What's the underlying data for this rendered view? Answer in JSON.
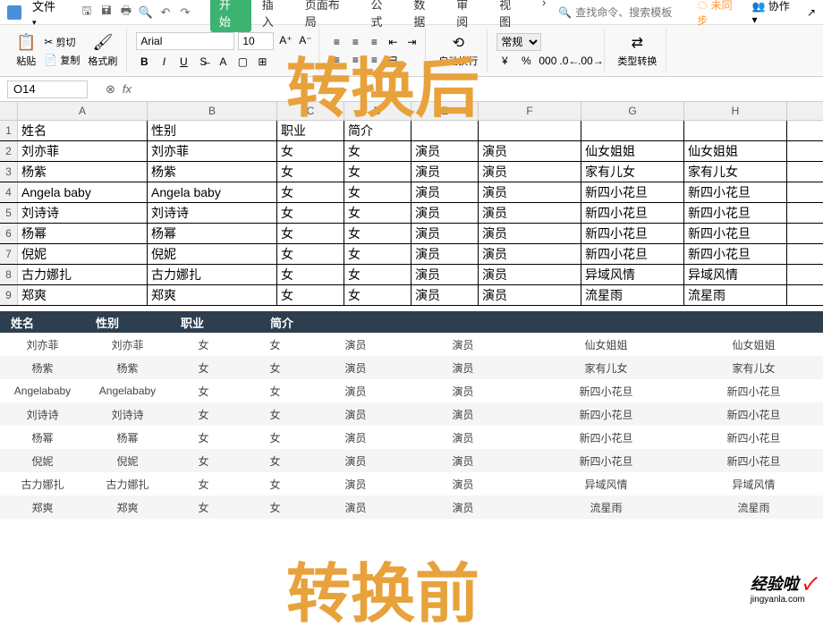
{
  "menu": {
    "file": "文件",
    "tabs": [
      "开始",
      "插入",
      "页面布局",
      "公式",
      "数据",
      "审阅",
      "视图"
    ],
    "search_placeholder": "查找命令、搜索模板",
    "sync": "未同步",
    "collab": "协作"
  },
  "ribbon": {
    "paste": "粘贴",
    "cut": "剪切",
    "copy": "复制",
    "format_painter": "格式刷",
    "font": "Arial",
    "size": "10",
    "wrap": "自动换行",
    "number_format": "常规",
    "type_convert": "类型转换"
  },
  "formula": {
    "cell_ref": "O14"
  },
  "cols": [
    "A",
    "B",
    "C",
    "D",
    "E",
    "F",
    "G",
    "H"
  ],
  "rows": [
    "1",
    "2",
    "3",
    "4",
    "5",
    "6",
    "7",
    "8",
    "9"
  ],
  "data": [
    [
      "姓名",
      "性别",
      "职业",
      "简介",
      "",
      "",
      "",
      ""
    ],
    [
      "刘亦菲",
      "刘亦菲",
      "女",
      "女",
      "演员",
      "演员",
      "仙女姐姐",
      "仙女姐姐"
    ],
    [
      "杨紫",
      "杨紫",
      "女",
      "女",
      "演员",
      "演员",
      "家有儿女",
      "家有儿女"
    ],
    [
      "Angela baby",
      "Angela baby",
      "女",
      "女",
      "演员",
      "演员",
      "新四小花旦",
      "新四小花旦"
    ],
    [
      "刘诗诗",
      "刘诗诗",
      "女",
      "女",
      "演员",
      "演员",
      "新四小花旦",
      "新四小花旦"
    ],
    [
      "杨幂",
      "杨幂",
      "女",
      "女",
      "演员",
      "演员",
      "新四小花旦",
      "新四小花旦"
    ],
    [
      "倪妮",
      "倪妮",
      "女",
      "女",
      "演员",
      "演员",
      "新四小花旦",
      "新四小花旦"
    ],
    [
      "古力娜扎",
      "古力娜扎",
      "女",
      "女",
      "演员",
      "演员",
      "异域风情",
      "异域风情"
    ],
    [
      "郑爽",
      "郑爽",
      "女",
      "女",
      "演员",
      "演员",
      "流星雨",
      "流星雨"
    ]
  ],
  "t2headers": [
    "姓名",
    "性别",
    "职业",
    "简介"
  ],
  "t2data": [
    [
      "刘亦菲",
      "刘亦菲",
      "女",
      "女",
      "演员",
      "演员",
      "仙女姐姐",
      "仙女姐姐"
    ],
    [
      "杨紫",
      "杨紫",
      "女",
      "女",
      "演员",
      "演员",
      "家有儿女",
      "家有儿女"
    ],
    [
      "Angelababy",
      "Angelababy",
      "女",
      "女",
      "演员",
      "演员",
      "新四小花旦",
      "新四小花旦"
    ],
    [
      "刘诗诗",
      "刘诗诗",
      "女",
      "女",
      "演员",
      "演员",
      "新四小花旦",
      "新四小花旦"
    ],
    [
      "杨幂",
      "杨幂",
      "女",
      "女",
      "演员",
      "演员",
      "新四小花旦",
      "新四小花旦"
    ],
    [
      "倪妮",
      "倪妮",
      "女",
      "女",
      "演员",
      "演员",
      "新四小花旦",
      "新四小花旦"
    ],
    [
      "古力娜扎",
      "古力娜扎",
      "女",
      "女",
      "演员",
      "演员",
      "异域风情",
      "异域风情"
    ],
    [
      "郑爽",
      "郑爽",
      "女",
      "女",
      "演员",
      "演员",
      "流星雨",
      "流星雨"
    ]
  ],
  "overlay1": "转换后",
  "overlay2": "转换前",
  "watermark": {
    "main": "经验啦",
    "sub": "jingyanla.com",
    "check": "✓"
  }
}
